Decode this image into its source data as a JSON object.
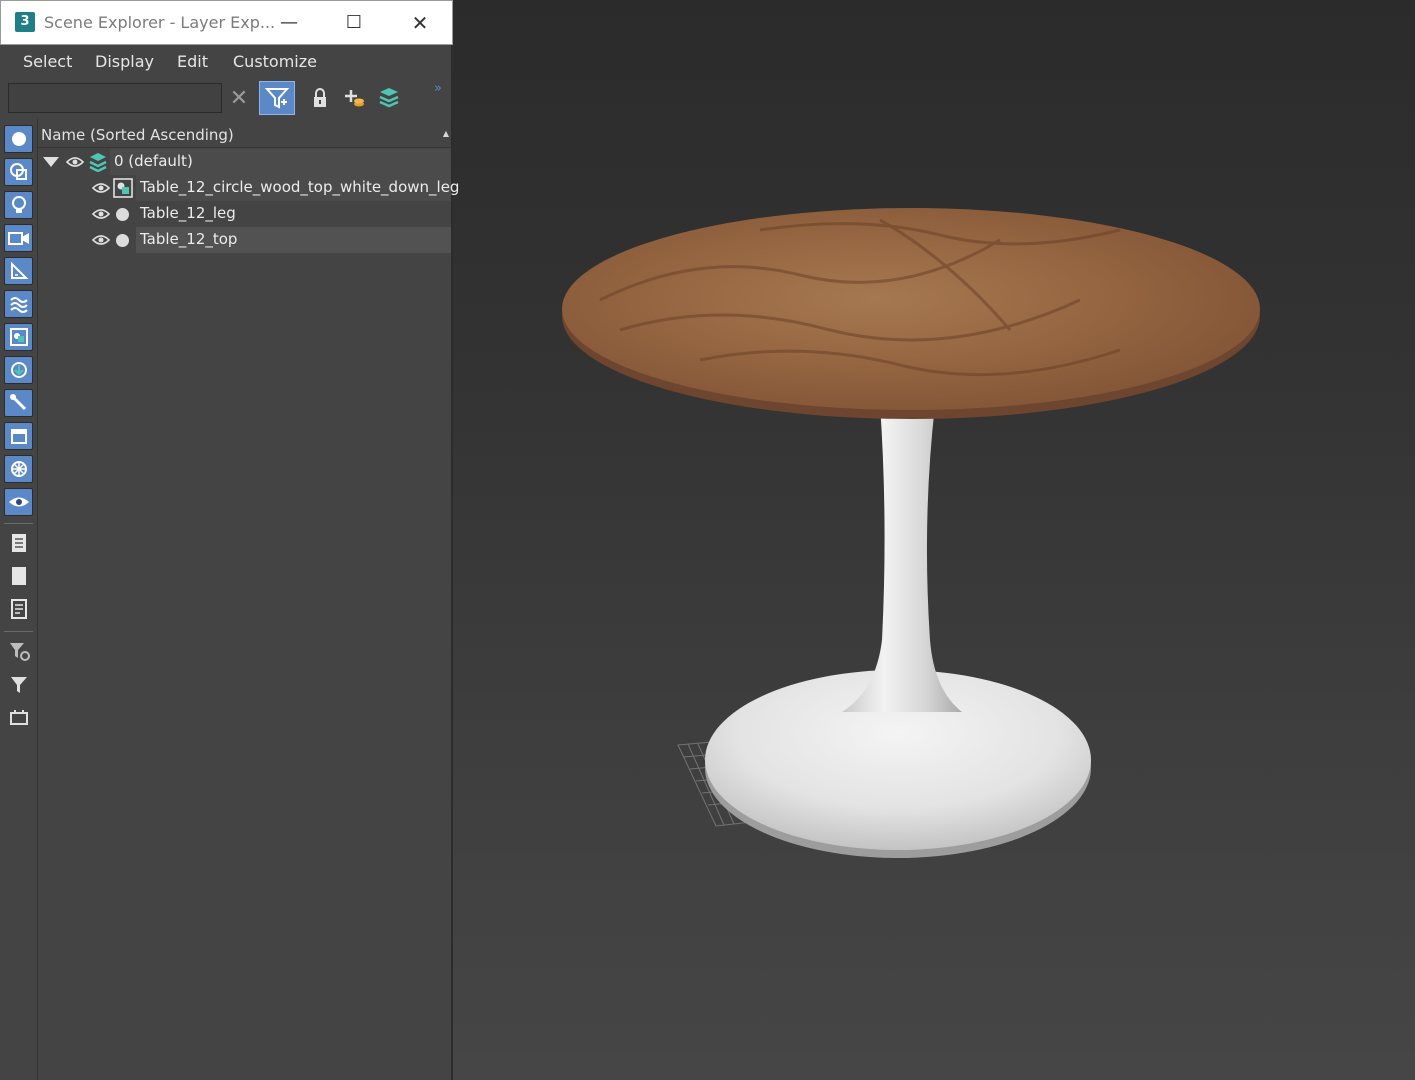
{
  "window": {
    "title": "Scene Explorer - Layer Exp...",
    "app_icon_text": "3",
    "minimize": "—",
    "maximize": "☐",
    "close": "✕"
  },
  "menu": {
    "items": [
      "Select",
      "Display",
      "Edit",
      "Customize"
    ]
  },
  "toolbar": {
    "search_value": "",
    "clear_glyph": "✕",
    "more_glyph": "»",
    "icons": [
      "clear-icon",
      "filter-toggle-icon",
      "lock-icon",
      "add-layer-icon",
      "layers-stack-icon"
    ]
  },
  "sidebar": {
    "icons": [
      "geometry-filter-icon",
      "shapes-filter-icon",
      "lights-filter-icon",
      "cameras-filter-icon",
      "helpers-filter-icon",
      "spacewarps-filter-icon",
      "groups-filter-icon",
      "xrefs-filter-icon",
      "bones-filter-icon",
      "containers-filter-icon",
      "frozen-filter-icon",
      "hidden-filter-icon",
      "display-all-icon",
      "display-none-icon",
      "invert-display-icon",
      "filter-settings-icon",
      "filter-icon",
      "selection-set-icon"
    ],
    "accent_color": "#5b88c7"
  },
  "tree": {
    "column_header": "Name (Sorted Ascending)",
    "sort_glyph": "▲",
    "layer": {
      "label": "0 (default)",
      "expanded": true
    },
    "objects": [
      {
        "label": "Table_12_circle_wood_top_white_down_leg",
        "icon": "group-object-icon"
      },
      {
        "label": "Table_12_leg",
        "icon": "object-dot-icon"
      },
      {
        "label": "Table_12_top",
        "icon": "object-dot-icon"
      }
    ]
  },
  "viewport": {
    "model": "round-pedestal-table",
    "top_material": "wood",
    "base_material": "white"
  }
}
